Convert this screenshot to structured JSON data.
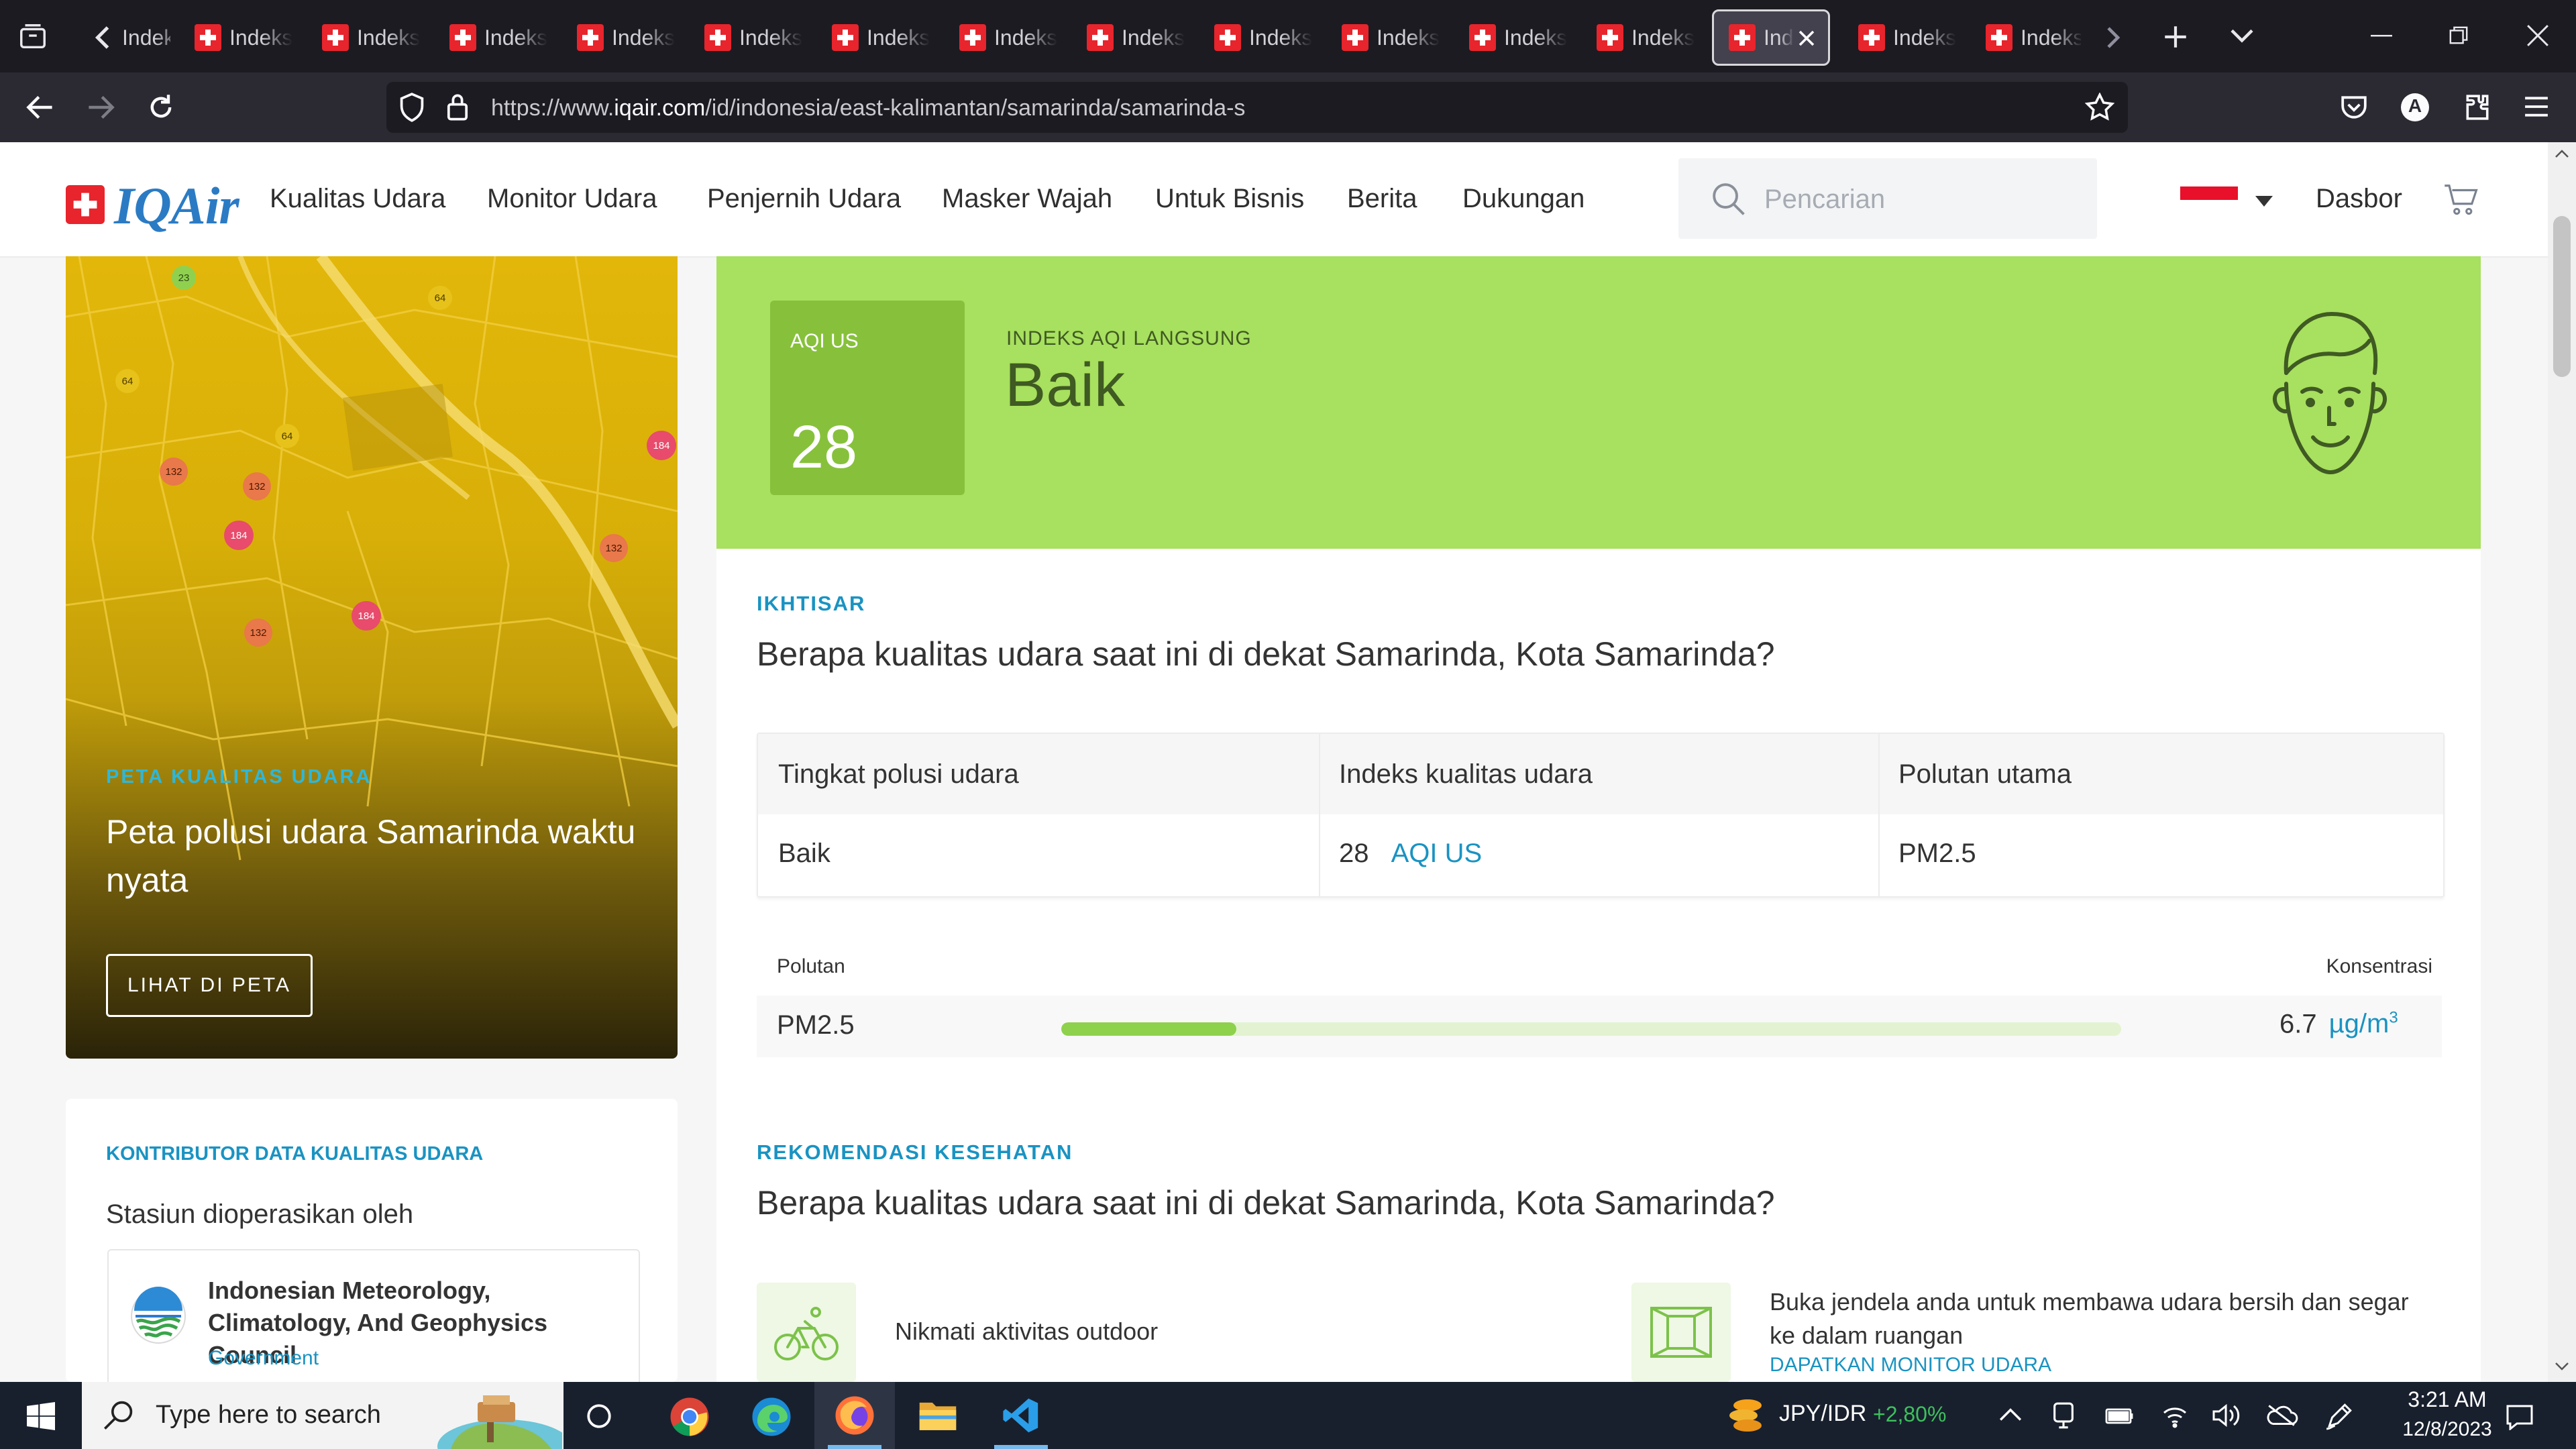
{
  "browser": {
    "tab_label": "Indeks",
    "active_tab_label": "Indeks",
    "first_tab_label": "Indeks",
    "url_prefix": "https://www.",
    "url_domain": "iqair.com",
    "url_path": "/id/indonesia/east-kalimantan/samarinda/samarinda-s",
    "profile_initial": "A"
  },
  "site": {
    "logo_text": "IQAir",
    "menu": [
      "Kualitas Udara",
      "Monitor Udara",
      "Penjernih Udara",
      "Masker Wajah",
      "Untuk Bisnis",
      "Berita",
      "Dukungan"
    ],
    "search_placeholder": "Pencarian",
    "dashboard_label": "Dasbor"
  },
  "map_card": {
    "eyebrow": "PETA KUALITAS UDARA",
    "title": "Peta polusi udara Samarinda waktu nyata",
    "button": "LIHAT DI PETA",
    "markers": [
      "23",
      "64",
      "64",
      "64",
      "132",
      "132",
      "132",
      "132",
      "184",
      "184",
      "184",
      "132"
    ]
  },
  "contributor": {
    "eyebrow": "KONTRIBUTOR DATA KUALITAS UDARA",
    "subtitle": "Stasiun dioperasikan oleh",
    "name": "Indonesian Meteorology, Climatology, And Geophysics Council",
    "type": "Government"
  },
  "aqi": {
    "label": "AQI US",
    "value": "28",
    "live_label": "INDEKS AQI LANGSUNG",
    "status": "Baik",
    "colors": {
      "banner": "#a8e05f",
      "box": "#87c13c",
      "text": "#3f5a22"
    }
  },
  "overview": {
    "eyebrow": "IKHTISAR",
    "question": "Berapa kualitas udara saat ini di dekat Samarinda, Kota Samarinda?",
    "headers": [
      "Tingkat polusi udara",
      "Indeks kualitas udara",
      "Polutan utama"
    ],
    "values": {
      "level": "Baik",
      "index": "28",
      "index_unit": "AQI US",
      "main_pollutant": "PM2.5"
    }
  },
  "pollutants": {
    "header_left": "Polutan",
    "header_right": "Konsentrasi",
    "rows": [
      {
        "name": "PM2.5",
        "value": "6.7",
        "unit": "µg/m",
        "unit_sup": "3",
        "level_fraction": 0.165
      }
    ]
  },
  "health": {
    "eyebrow": "REKOMENDASI KESEHATAN",
    "question": "Berapa kualitas udara saat ini di dekat Samarinda, Kota Samarinda?",
    "rec1": "Nikmati aktivitas outdoor",
    "rec2": "Buka jendela anda untuk membawa udara bersih dan segar ke dalam ruangan",
    "rec2_link": "DAPATKAN MONITOR UDARA"
  },
  "taskbar": {
    "search_placeholder": "Type here to search",
    "ticker_name": "JPY/IDR",
    "ticker_value": "+2,80%",
    "time": "3:21 AM",
    "date": "12/8/2023"
  }
}
